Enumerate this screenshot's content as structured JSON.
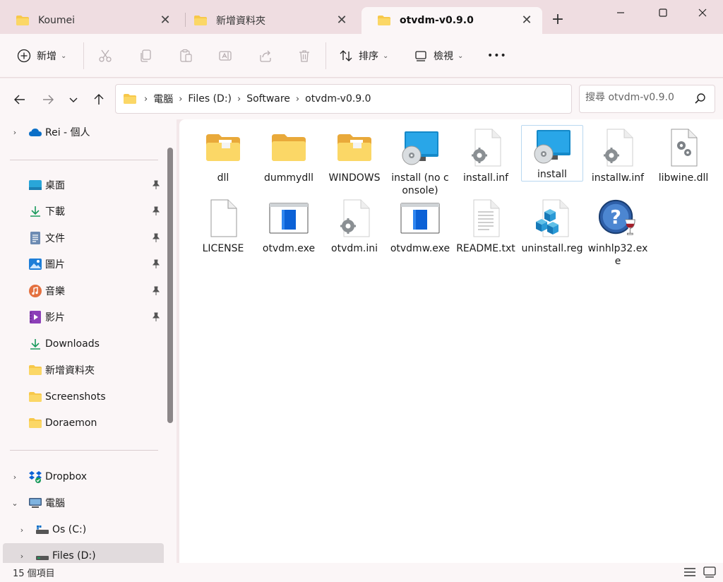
{
  "tabs": [
    {
      "label": "Koumei",
      "active": false
    },
    {
      "label": "新增資料夾",
      "active": false
    },
    {
      "label": "otvdm-v0.9.0",
      "active": true
    }
  ],
  "window": {
    "new_tab": "+"
  },
  "toolbar": {
    "new_label": "新增",
    "sort_label": "排序",
    "view_label": "檢視",
    "more_label": "•••"
  },
  "address": {
    "crumbs": [
      "電腦",
      "Files (D:)",
      "Software",
      "otvdm-v0.9.0"
    ],
    "search_placeholder": "搜尋 otvdm-v0.9.0"
  },
  "sidebar": {
    "onedrive": "Rei - 個人",
    "quick": [
      {
        "label": "桌面",
        "icon": "desktop-icon"
      },
      {
        "label": "下載",
        "icon": "download-icon"
      },
      {
        "label": "文件",
        "icon": "document-icon"
      },
      {
        "label": "圖片",
        "icon": "picture-icon"
      },
      {
        "label": "音樂",
        "icon": "music-icon"
      },
      {
        "label": "影片",
        "icon": "video-icon"
      }
    ],
    "folders": [
      "Downloads",
      "新增資料夾",
      "Screenshots",
      "Doraemon"
    ],
    "dropbox": "Dropbox",
    "computer": "電腦",
    "drives": [
      "Os (C:)",
      "Files (D:)"
    ]
  },
  "files": [
    {
      "name": "dll",
      "type": "folder-doc"
    },
    {
      "name": "dummydll",
      "type": "folder"
    },
    {
      "name": "WINDOWS",
      "type": "folder-doc"
    },
    {
      "name": "install (no console)",
      "type": "installer"
    },
    {
      "name": "install.inf",
      "type": "config"
    },
    {
      "name": "install",
      "type": "installer"
    },
    {
      "name": "installw.inf",
      "type": "config"
    },
    {
      "name": "libwine.dll",
      "type": "dll"
    },
    {
      "name": "LICENSE",
      "type": "blank"
    },
    {
      "name": "otvdm.exe",
      "type": "exe"
    },
    {
      "name": "otvdm.ini",
      "type": "config"
    },
    {
      "name": "otvdmw.exe",
      "type": "exe"
    },
    {
      "name": "README.txt",
      "type": "text"
    },
    {
      "name": "uninstall.reg",
      "type": "reg"
    },
    {
      "name": "winhlp32.exe",
      "type": "help"
    }
  ],
  "status": {
    "count": "15 個項目"
  },
  "colors": {
    "folder": "#f7c84a",
    "accent": "#0b6fc7",
    "tab_bg": "#efdde1"
  }
}
